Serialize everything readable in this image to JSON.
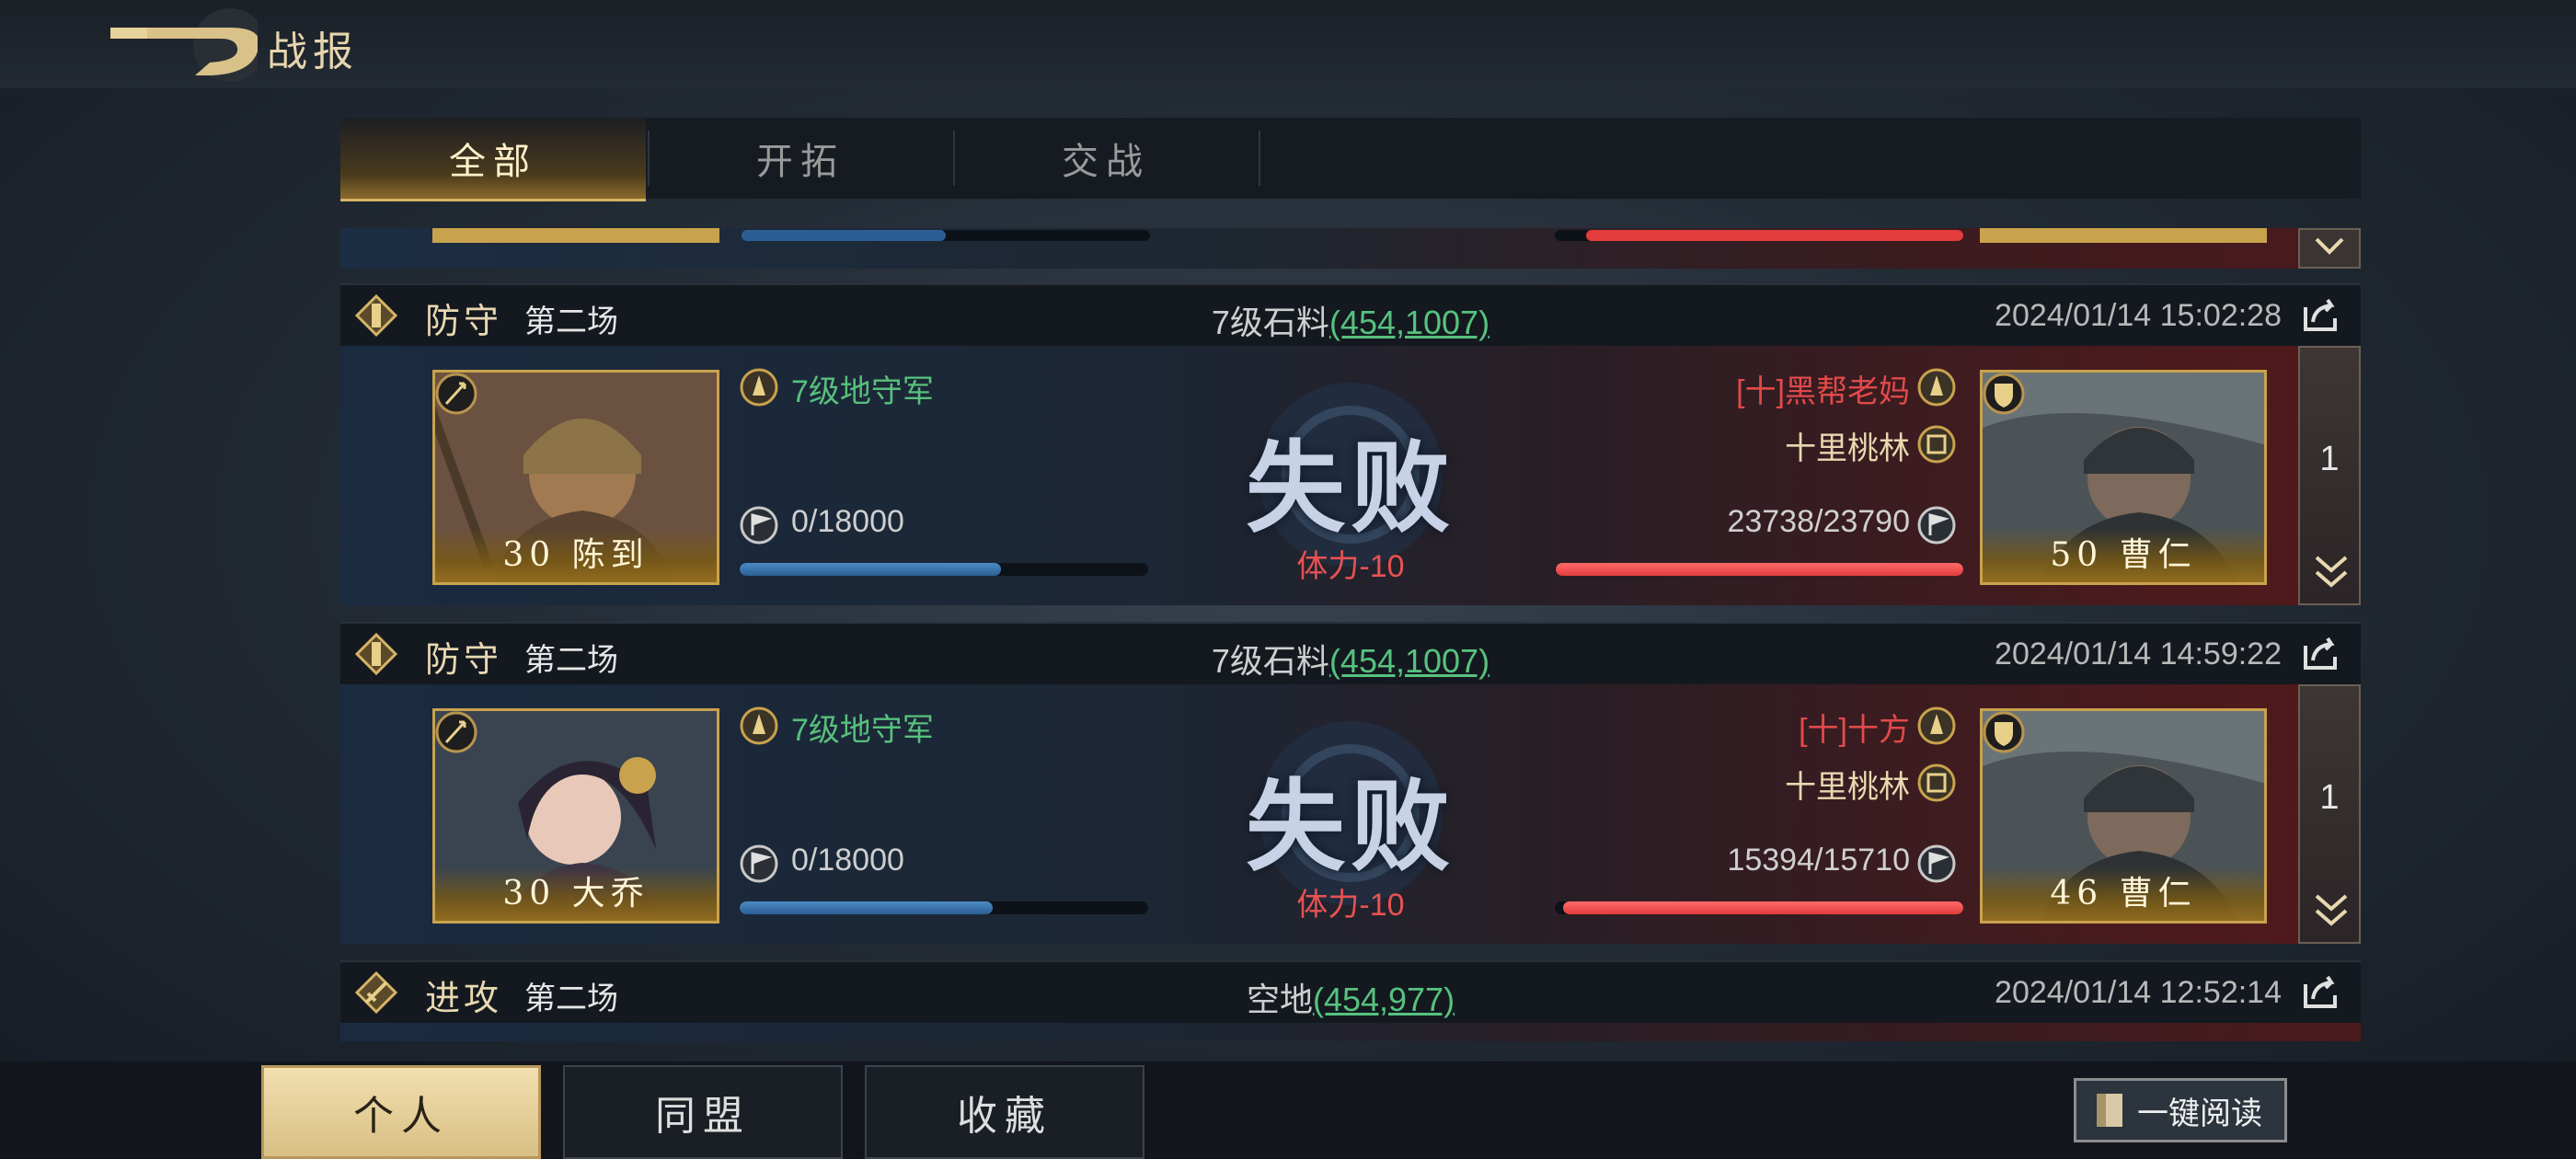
{
  "header": {
    "title": "战报"
  },
  "tabs": [
    {
      "label": "全部",
      "active": true
    },
    {
      "label": "开拓",
      "active": false
    },
    {
      "label": "交战",
      "active": false
    }
  ],
  "reports": [
    {
      "type": "防守",
      "round": "第二场",
      "location_name": "7级石料",
      "coords": "(454,1007)",
      "time": "2024/01/14 15:02:28",
      "attacker": {
        "name": "7级地守军",
        "troops": "0/18000",
        "troop_ratio": 0.64,
        "hero_level": "30",
        "hero_name": "陈到"
      },
      "result": "失败",
      "stamina": "体力-10",
      "defender": {
        "player": "[十]黑帮老妈",
        "city": "十里桃林",
        "troops": "23738/23790",
        "troop_ratio": 0.998,
        "hero_level": "50",
        "hero_name": "曹仁"
      },
      "count": "1"
    },
    {
      "type": "防守",
      "round": "第二场",
      "location_name": "7级石料",
      "coords": "(454,1007)",
      "time": "2024/01/14 14:59:22",
      "attacker": {
        "name": "7级地守军",
        "troops": "0/18000",
        "troop_ratio": 0.62,
        "hero_level": "30",
        "hero_name": "大乔"
      },
      "result": "失败",
      "stamina": "体力-10",
      "defender": {
        "player": "[十]十方",
        "city": "十里桃林",
        "troops": "15394/15710",
        "troop_ratio": 0.98,
        "hero_level": "46",
        "hero_name": "曹仁"
      },
      "count": "1"
    },
    {
      "type": "进攻",
      "round": "第二场",
      "location_name": "空地",
      "coords": "(454,977)",
      "time": "2024/01/14 12:52:14"
    }
  ],
  "bottom_tabs": [
    {
      "label": "个人",
      "active": true
    },
    {
      "label": "同盟",
      "active": false
    },
    {
      "label": "收藏",
      "active": false
    }
  ],
  "read_all_label": "一键阅读",
  "colors": {
    "gold": "#d6b466",
    "coord_green": "#57c27f",
    "red": "#e24a4a",
    "blue_bar": "#2b5f93"
  }
}
